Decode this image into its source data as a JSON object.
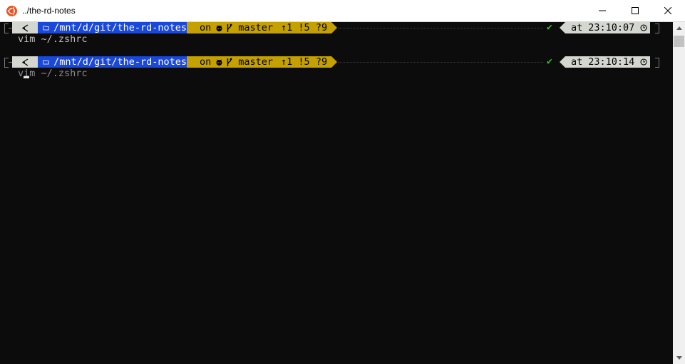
{
  "window": {
    "title": "../the-rd-notes",
    "controls": {
      "minimize": "minimize-icon",
      "maximize": "maximize-icon",
      "close": "close-icon"
    }
  },
  "prompts": [
    {
      "os_icon": "linux-icon",
      "folder_icon": "folder-icon",
      "path": "/mnt/d/git/the-rd-notes",
      "on": "on",
      "host_icon": "github-icon",
      "branch_icon": "git-branch-icon",
      "branch": "master",
      "status": "↑1 !5 ?9",
      "status_ok": "✔",
      "at": "at",
      "time": "23:10:07",
      "clock_icon": "clock-icon",
      "command": "vim ~/.zshrc"
    },
    {
      "os_icon": "linux-icon",
      "folder_icon": "folder-icon",
      "path": "/mnt/d/git/the-rd-notes",
      "on": "on",
      "host_icon": "github-icon",
      "branch_icon": "git-branch-icon",
      "branch": "master",
      "status": "↑1 !5 ?9",
      "status_ok": "✔",
      "at": "at",
      "time": "23:10:14",
      "clock_icon": "clock-icon",
      "command": "vim ~/.zshrc"
    }
  ],
  "colors": {
    "background": "#0c0c0c",
    "path_segment": "#1a48d8",
    "git_segment": "#c4a000",
    "os_time_segment": "#d3d7cf",
    "check": "#3dbf2f",
    "frame": "#7a7a7a"
  }
}
